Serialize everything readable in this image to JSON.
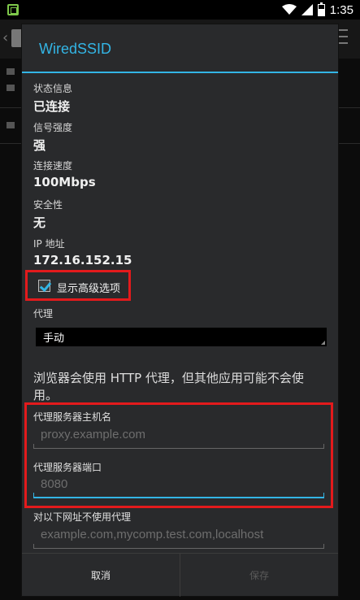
{
  "status_bar": {
    "time": "1:35"
  },
  "dialog": {
    "title": "WiredSSID",
    "info": [
      {
        "label": "状态信息",
        "value": "已连接"
      },
      {
        "label": "信号强度",
        "value": "强"
      },
      {
        "label": "连接速度",
        "value": "100Mbps"
      },
      {
        "label": "安全性",
        "value": "无"
      },
      {
        "label": "IP 地址",
        "value": "172.16.152.15"
      }
    ],
    "advanced_checkbox": {
      "label": "显示高级选项",
      "checked": true
    },
    "proxy": {
      "label": "代理",
      "selected": "手动"
    },
    "proxy_note": "浏览器会使用 HTTP 代理，但其他应用可能不会使用。",
    "hostname": {
      "label": "代理服务器主机名",
      "placeholder": "proxy.example.com"
    },
    "port": {
      "label": "代理服务器端口",
      "placeholder": "8080"
    },
    "exclusion": {
      "label": "对以下网址不使用代理",
      "placeholder": "example.com,mycomp.test.com,localhost"
    },
    "buttons": {
      "cancel": "取消",
      "save": "保存"
    }
  },
  "colors": {
    "accent": "#33b5e5",
    "highlight": "#e31a1c",
    "dialog_bg": "#292a2c"
  }
}
